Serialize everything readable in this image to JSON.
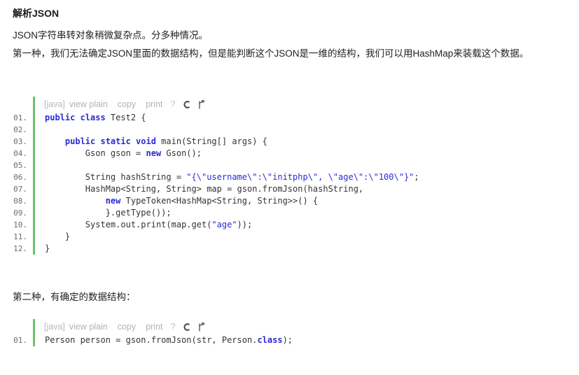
{
  "article": {
    "heading": "解析JSON",
    "paragraphs": [
      "JSON字符串转对象稍微复杂点。分多种情况。",
      "第一种，我们无法确定JSON里面的数据结构，但是能判断这个JSON是一维的结构，我们可以用HashMap来装载这个数据。"
    ],
    "paragraph2": "第二种，有确定的数据结构："
  },
  "toolbar": {
    "language": "[java]",
    "view_plain": "view plain",
    "copy": "copy",
    "print": "print",
    "help": "?",
    "icons": {
      "reset": "reset-icon",
      "fork": "fork-icon"
    }
  },
  "colors": {
    "accent_green": "#6ac46a",
    "keyword_blue": "#2b2bd6",
    "string_blue": "#2b2bd6",
    "toolbar_gray": "#b2b2b2",
    "line_number_gray": "#6c6c6c",
    "code_text": "#333333"
  },
  "code_block_1": {
    "language": "java",
    "lines": [
      {
        "num": "01.",
        "tokens": [
          {
            "t": "public class",
            "c": "kw"
          },
          {
            "t": " Test2 {",
            "c": "pln"
          }
        ]
      },
      {
        "num": "02.",
        "tokens": [
          {
            "t": "",
            "c": "pln"
          }
        ]
      },
      {
        "num": "03.",
        "tokens": [
          {
            "t": "    ",
            "c": "pln"
          },
          {
            "t": "public static void",
            "c": "kw"
          },
          {
            "t": " main(String[] args) {",
            "c": "pln"
          }
        ]
      },
      {
        "num": "04.",
        "tokens": [
          {
            "t": "        Gson gson = ",
            "c": "pln"
          },
          {
            "t": "new",
            "c": "kw"
          },
          {
            "t": " Gson();",
            "c": "pln"
          }
        ]
      },
      {
        "num": "05.",
        "tokens": [
          {
            "t": "",
            "c": "pln"
          }
        ]
      },
      {
        "num": "06.",
        "tokens": [
          {
            "t": "        String hashString = ",
            "c": "pln"
          },
          {
            "t": "\"{\\\"username\\\":\\\"initphp\\\", \\\"age\\\":\\\"100\\\"}\"",
            "c": "str"
          },
          {
            "t": ";",
            "c": "pln"
          }
        ]
      },
      {
        "num": "07.",
        "tokens": [
          {
            "t": "        HashMap<String, String> map = gson.fromJson(hashString,",
            "c": "pln"
          }
        ]
      },
      {
        "num": "08.",
        "tokens": [
          {
            "t": "            ",
            "c": "pln"
          },
          {
            "t": "new",
            "c": "kw"
          },
          {
            "t": " TypeToken<HashMap<String, String>>() {",
            "c": "pln"
          }
        ]
      },
      {
        "num": "09.",
        "tokens": [
          {
            "t": "            }.getType());",
            "c": "pln"
          }
        ]
      },
      {
        "num": "10.",
        "tokens": [
          {
            "t": "        System.out.print(map.get(",
            "c": "pln"
          },
          {
            "t": "\"age\"",
            "c": "str"
          },
          {
            "t": "));",
            "c": "pln"
          }
        ]
      },
      {
        "num": "11.",
        "tokens": [
          {
            "t": "    }",
            "c": "pln"
          }
        ]
      },
      {
        "num": "12.",
        "tokens": [
          {
            "t": "}",
            "c": "pln"
          }
        ]
      }
    ]
  },
  "code_block_2": {
    "language": "java",
    "lines": [
      {
        "num": "01.",
        "tokens": [
          {
            "t": "Person person = gson.fromJson(str, Person.",
            "c": "pln"
          },
          {
            "t": "class",
            "c": "kw"
          },
          {
            "t": ");",
            "c": "pln"
          }
        ]
      }
    ]
  }
}
